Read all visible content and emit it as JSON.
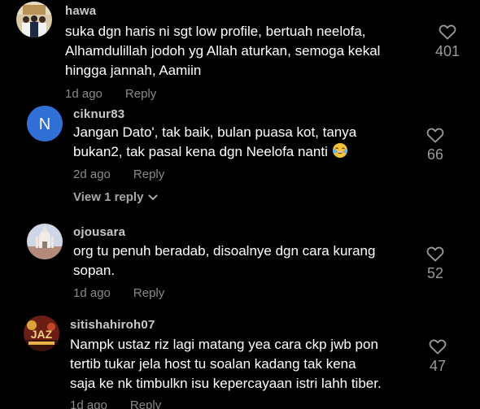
{
  "comments": [
    {
      "username": "hawa",
      "lines": [
        "suka dgn haris ni sgt low profile, bertuah neelofa,",
        "Alhamdulillah jodoh yg Allah aturkan, semoga kekal",
        "hingga jannah, Aamiin"
      ],
      "time": "1d ago",
      "reply": "Reply",
      "likes": "401"
    },
    {
      "username": "ciknur83",
      "avatar_letter": "N",
      "lines": [
        "Jangan Dato', tak baik, bulan puasa kot, tanya",
        "bukan2, tak pasal kena dgn Neelofa nanti"
      ],
      "time": "2d ago",
      "reply": "Reply",
      "likes": "66",
      "view_replies": "View 1 reply"
    },
    {
      "username": "ojousara",
      "lines": [
        "org tu penuh beradab, disoalnye dgn cara kurang",
        "sopan."
      ],
      "time": "1d ago",
      "reply": "Reply",
      "likes": "52"
    },
    {
      "username": "sitishahiroh07",
      "lines": [
        "Nampk ustaz riz lagi matang yea cara ckp jwb pon",
        "tertib tukar jela host tu soalan kadang tak kena",
        "saja ke nk timbulkn isu kepercayaan istri lahh tiber."
      ],
      "time": "1d ago",
      "reply": "Reply",
      "likes": "47"
    }
  ],
  "colors": {
    "background": "#000000",
    "avatar_blue": "#2f6fd6"
  },
  "icons": {
    "like": "heart-outline-icon",
    "expand": "chevron-down-icon",
    "emoji": "laughing-tears-emoji"
  }
}
